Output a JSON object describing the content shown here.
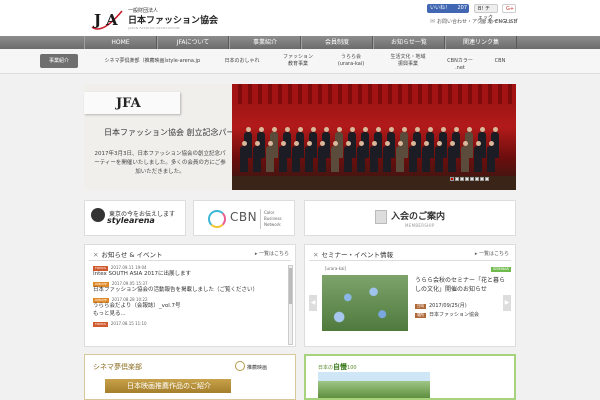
{
  "header": {
    "logo_mark": "JFA",
    "logo_line1": "一般財団法人",
    "logo_line2": "日本ファッション協会",
    "logo_line3": "JAPAN FASHION ASSOCIATION",
    "fb_label": "いいね！",
    "fb_count": "207",
    "hatena_label": "B! チェック",
    "gplus_label": "G+",
    "contact_link": "お問い合わせ・アクセス",
    "sitemap_link": "サイトマップ",
    "english_link": "ENGLISH"
  },
  "gnav": [
    {
      "label": "HOME"
    },
    {
      "label": "JFAについて"
    },
    {
      "label": "事業紹介"
    },
    {
      "label": "会員制度"
    },
    {
      "label": "お知らせ一覧"
    },
    {
      "label": "関連リンク集"
    }
  ],
  "subnav": [
    {
      "label": "事業紹介",
      "active": true
    },
    {
      "label": "シネマ夢倶楽部（推薦映画）",
      "active": false
    },
    {
      "label": "style-arena.jp",
      "active": false
    },
    {
      "label": "日本のおしゃれ",
      "active": false
    },
    {
      "label": "ファッション\n教育事業",
      "active": false
    },
    {
      "label": "うらら会\n(urara-kai)",
      "active": false
    },
    {
      "label": "生活文化・地域\n振興事業",
      "active": false
    },
    {
      "label": "CBNカラー .net",
      "active": false
    },
    {
      "label": "CBN",
      "active": false
    }
  ],
  "hero": {
    "title": "日本ファッション協会 創立記念パーティー",
    "description": "2017年3月3日、日本ファッション協会の創立記念パーティーを開催いたしました。多くの会員の方にご参加いただきました。"
  },
  "banners": {
    "style_arena_top": "東京の今をお伝えします",
    "style_arena_name": "stylearena",
    "cbn_name": "CBN",
    "cbn_sub": "Color\nBusiness\nNetwork",
    "join_title": "入会のご案内",
    "join_sub": "MEMBERSHIP"
  },
  "news": {
    "title": "お知らせ & イベント",
    "more": "一覧はこちら",
    "items": [
      {
        "badge": "TOPICS",
        "badge_color": "#d05a2e",
        "date": "2017.09.11 19:04",
        "text": "Intex SOUTH ASIA 2017に出展します"
      },
      {
        "badge": "UPDATE",
        "badge_color": "#e08a2a",
        "date": "2017.09.05 15:37",
        "text": "日本ファッション協会の活動報告を掲載しました（ご覧ください）"
      },
      {
        "badge": "UPDATE",
        "badge_color": "#e08a2a",
        "date": "2017.08.28 10:22",
        "text": "うらら会だより（会報誌）_vol.7号"
      },
      {
        "badge": "",
        "badge_color": "#ffffff",
        "date": "",
        "text": "もっと見る..."
      },
      {
        "badge": "TOPICS",
        "badge_color": "#d05a2e",
        "date": "2017.08.15 11:10",
        "text": ""
      }
    ]
  },
  "events": {
    "title": "セミナー・イベント情報",
    "more": "一覧はこちら",
    "category": "[urara-kai]",
    "seminar_badge": "SEMINAR",
    "event_title": "うらら会秋のセミナー「花と暮らしの文化」開催のお知らせ",
    "date_label": "日時",
    "date_value": "2017/09/25(月)",
    "place_label": "場所",
    "place_value": "日本ファッション協会"
  },
  "cinema": {
    "brand": "シネマ夢倶楽部",
    "gold_text": "日本映画推薦作品のご紹介",
    "recommend": "推薦映画"
  },
  "japan_pride": {
    "label": "日本の",
    "bold": "自慢",
    "suffix": "100"
  },
  "colors": {
    "nav_gray": "#7d7d7d",
    "hero_red": "#a31313",
    "seminar_green": "#6fba4c",
    "gold": "#b89a4e"
  }
}
